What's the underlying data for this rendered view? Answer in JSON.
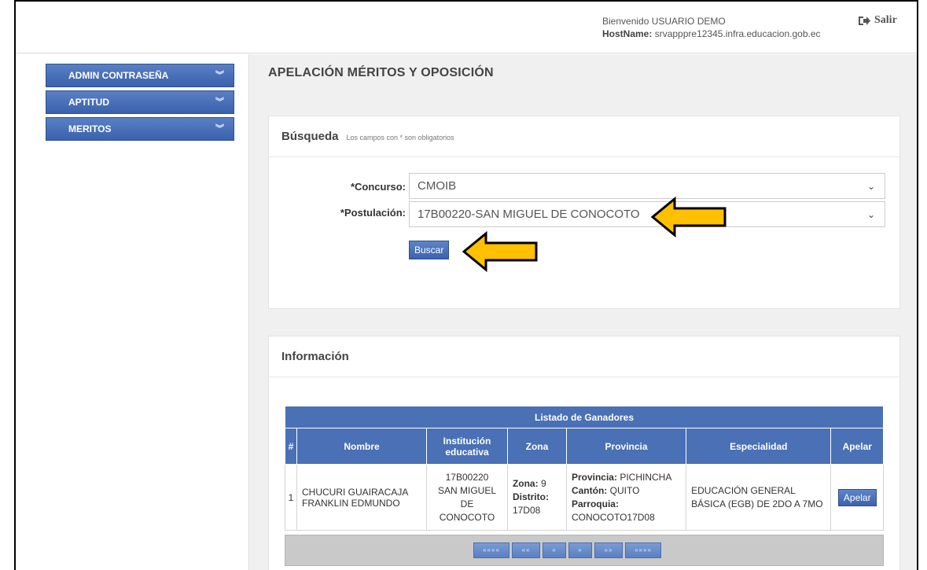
{
  "header": {
    "welcome": "Bienvenido USUARIO DEMO",
    "hostname_label": "HostName:",
    "hostname_value": "srvapppre12345.infra.educacion.gob.ec",
    "logout_label": "Salir"
  },
  "sidebar": {
    "items": [
      {
        "label": "ADMIN CONTRASEÑA"
      },
      {
        "label": "APTITUD"
      },
      {
        "label": "MERITOS"
      }
    ],
    "chevron": "»"
  },
  "page": {
    "title": "APELACIÓN MÉRITOS Y OPOSICIÓN"
  },
  "search": {
    "title": "Búsqueda",
    "note": "Los campos con * son obligatorios",
    "concurso_label": "*Concurso:",
    "concurso_value": "CMOIB",
    "postulacion_label": "*Postulación:",
    "postulacion_value": "17B00220-SAN MIGUEL DE CONOCOTO",
    "button_label": "Buscar"
  },
  "info": {
    "title": "Información",
    "table_caption": "Listado de Ganadores",
    "columns": [
      "#",
      "Nombre",
      "Institución educativa",
      "Zona",
      "Provincia",
      "Especialidad",
      "Apelar"
    ],
    "rows": [
      {
        "num": "1",
        "nombre": "CHUCURI GUAIRACAJA FRANKLIN EDMUNDO",
        "institucion_codigo": "17B00220",
        "institucion_nombre": "SAN MIGUEL DE CONOCOTO",
        "zona_label": "Zona:",
        "zona_value": "9",
        "distrito_label": "Distrito:",
        "distrito_value": "17D08",
        "provincia_label": "Provincia:",
        "provincia_value": "PICHINCHA",
        "canton_label": "Cantón:",
        "canton_value": "QUITO",
        "parroquia_label": "Parroquia:",
        "parroquia_value": "CONOCOTO17D08",
        "especialidad": "EDUCACIÓN GENERAL BÁSICA (EGB) DE 2DO A 7MO",
        "action_label": "Apelar"
      }
    ],
    "pager": [
      "««««",
      "««",
      "«",
      "»",
      "»»",
      "»»»»"
    ]
  },
  "colors": {
    "accent": "#4a70b5",
    "arrow_fill": "#ffc000",
    "content_bg": "#f0f0f0"
  }
}
